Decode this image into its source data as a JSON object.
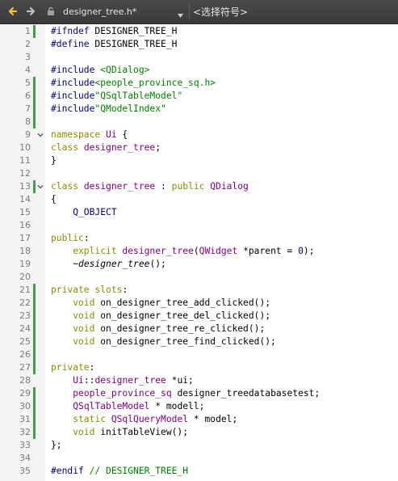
{
  "toolbar": {
    "file_name": "designer_tree.h*",
    "symbol_placeholder": "<选择符号>"
  },
  "lines": [
    {
      "n": "1",
      "mark": true,
      "fold": false,
      "tokens": [
        {
          "t": "#ifndef ",
          "c": "pp"
        },
        {
          "t": "DESIGNER_TREE_H",
          "c": "plain"
        }
      ]
    },
    {
      "n": "2",
      "mark": false,
      "fold": false,
      "tokens": [
        {
          "t": "#define ",
          "c": "pp"
        },
        {
          "t": "DESIGNER_TREE_H",
          "c": "plain"
        }
      ]
    },
    {
      "n": "3",
      "mark": false,
      "fold": false,
      "tokens": []
    },
    {
      "n": "4",
      "mark": false,
      "fold": false,
      "tokens": [
        {
          "t": "#include ",
          "c": "pp"
        },
        {
          "t": "<QDialog>",
          "c": "str"
        }
      ]
    },
    {
      "n": "5",
      "mark": true,
      "fold": false,
      "tokens": [
        {
          "t": "#include",
          "c": "pp"
        },
        {
          "t": "<people_province_sq.h>",
          "c": "str"
        }
      ]
    },
    {
      "n": "6",
      "mark": true,
      "fold": false,
      "tokens": [
        {
          "t": "#include",
          "c": "pp"
        },
        {
          "t": "\"QSqlTableModel\"",
          "c": "str"
        }
      ]
    },
    {
      "n": "7",
      "mark": true,
      "fold": false,
      "tokens": [
        {
          "t": "#include",
          "c": "pp"
        },
        {
          "t": "\"QModelIndex\"",
          "c": "str"
        }
      ]
    },
    {
      "n": "8",
      "mark": true,
      "fold": false,
      "tokens": []
    },
    {
      "n": "9",
      "mark": false,
      "fold": true,
      "tokens": [
        {
          "t": "namespace ",
          "c": "kw"
        },
        {
          "t": "Ui ",
          "c": "cls"
        },
        {
          "t": "{",
          "c": "plain"
        }
      ]
    },
    {
      "n": "10",
      "mark": false,
      "fold": false,
      "tokens": [
        {
          "t": "class ",
          "c": "kw"
        },
        {
          "t": "designer_tree",
          "c": "cls"
        },
        {
          "t": ";",
          "c": "plain"
        }
      ]
    },
    {
      "n": "11",
      "mark": false,
      "fold": false,
      "tokens": [
        {
          "t": "}",
          "c": "plain"
        }
      ]
    },
    {
      "n": "12",
      "mark": false,
      "fold": false,
      "tokens": []
    },
    {
      "n": "13",
      "mark": true,
      "fold": true,
      "tokens": [
        {
          "t": "class ",
          "c": "kw"
        },
        {
          "t": "designer_tree ",
          "c": "cls"
        },
        {
          "t": ": ",
          "c": "plain"
        },
        {
          "t": "public ",
          "c": "kw"
        },
        {
          "t": "QDialog",
          "c": "cls"
        }
      ]
    },
    {
      "n": "14",
      "mark": false,
      "fold": false,
      "tokens": [
        {
          "t": "{",
          "c": "plain"
        }
      ]
    },
    {
      "n": "15",
      "mark": false,
      "fold": false,
      "tokens": [
        {
          "t": "    Q_OBJECT",
          "c": "pp"
        }
      ]
    },
    {
      "n": "16",
      "mark": false,
      "fold": false,
      "tokens": []
    },
    {
      "n": "17",
      "mark": false,
      "fold": false,
      "tokens": [
        {
          "t": "public",
          "c": "kw"
        },
        {
          "t": ":",
          "c": "plain"
        }
      ]
    },
    {
      "n": "18",
      "mark": false,
      "fold": false,
      "tokens": [
        {
          "t": "    explicit ",
          "c": "kw"
        },
        {
          "t": "designer_tree",
          "c": "ty"
        },
        {
          "t": "(",
          "c": "plain"
        },
        {
          "t": "QWidget ",
          "c": "cls"
        },
        {
          "t": "*parent = ",
          "c": "plain"
        },
        {
          "t": "0",
          "c": "pp"
        },
        {
          "t": ");",
          "c": "plain"
        }
      ]
    },
    {
      "n": "19",
      "mark": false,
      "fold": false,
      "tokens": [
        {
          "t": "    ~",
          "c": "plain"
        },
        {
          "t": "designer_tree",
          "c": "it"
        },
        {
          "t": "();",
          "c": "plain"
        }
      ]
    },
    {
      "n": "20",
      "mark": false,
      "fold": false,
      "tokens": []
    },
    {
      "n": "21",
      "mark": true,
      "fold": false,
      "tokens": [
        {
          "t": "private ",
          "c": "kw"
        },
        {
          "t": "slots",
          "c": "kw"
        },
        {
          "t": ":",
          "c": "plain"
        }
      ]
    },
    {
      "n": "22",
      "mark": true,
      "fold": false,
      "tokens": [
        {
          "t": "    void ",
          "c": "kw"
        },
        {
          "t": "on_designer_tree_add_clicked();",
          "c": "plain"
        }
      ]
    },
    {
      "n": "23",
      "mark": true,
      "fold": false,
      "tokens": [
        {
          "t": "    void ",
          "c": "kw"
        },
        {
          "t": "on_designer_tree_del_clicked();",
          "c": "plain"
        }
      ]
    },
    {
      "n": "24",
      "mark": true,
      "fold": false,
      "tokens": [
        {
          "t": "    void ",
          "c": "kw"
        },
        {
          "t": "on_designer_tree_re_clicked();",
          "c": "plain"
        }
      ]
    },
    {
      "n": "25",
      "mark": true,
      "fold": false,
      "tokens": [
        {
          "t": "    void ",
          "c": "kw"
        },
        {
          "t": "on_designer_tree_find_clicked();",
          "c": "plain"
        }
      ]
    },
    {
      "n": "26",
      "mark": true,
      "fold": false,
      "tokens": []
    },
    {
      "n": "27",
      "mark": true,
      "fold": false,
      "tokens": [
        {
          "t": "private",
          "c": "kw"
        },
        {
          "t": ":",
          "c": "plain"
        }
      ]
    },
    {
      "n": "28",
      "mark": false,
      "fold": false,
      "tokens": [
        {
          "t": "    ",
          "c": "plain"
        },
        {
          "t": "Ui",
          "c": "cls"
        },
        {
          "t": "::",
          "c": "plain"
        },
        {
          "t": "designer_tree ",
          "c": "cls"
        },
        {
          "t": "*ui;",
          "c": "plain"
        }
      ]
    },
    {
      "n": "29",
      "mark": true,
      "fold": false,
      "tokens": [
        {
          "t": "    ",
          "c": "plain"
        },
        {
          "t": "people_province_sq ",
          "c": "cls"
        },
        {
          "t": "designer_treedatabasetest;",
          "c": "plain"
        }
      ]
    },
    {
      "n": "30",
      "mark": true,
      "fold": false,
      "tokens": [
        {
          "t": "    ",
          "c": "plain"
        },
        {
          "t": "QSqlTableModel ",
          "c": "cls"
        },
        {
          "t": "* modell;",
          "c": "plain"
        }
      ]
    },
    {
      "n": "31",
      "mark": true,
      "fold": false,
      "tokens": [
        {
          "t": "    static ",
          "c": "kw"
        },
        {
          "t": "QSqlQueryModel ",
          "c": "cls"
        },
        {
          "t": "* model;",
          "c": "plain"
        }
      ]
    },
    {
      "n": "32",
      "mark": true,
      "fold": false,
      "tokens": [
        {
          "t": "    void ",
          "c": "kw"
        },
        {
          "t": "initTableView();",
          "c": "plain"
        }
      ]
    },
    {
      "n": "33",
      "mark": false,
      "fold": false,
      "tokens": [
        {
          "t": "};",
          "c": "plain"
        }
      ]
    },
    {
      "n": "34",
      "mark": false,
      "fold": false,
      "tokens": []
    },
    {
      "n": "35",
      "mark": false,
      "fold": false,
      "tokens": [
        {
          "t": "#endif ",
          "c": "pp"
        },
        {
          "t": "// DESIGNER_TREE_H",
          "c": "str"
        }
      ]
    }
  ]
}
